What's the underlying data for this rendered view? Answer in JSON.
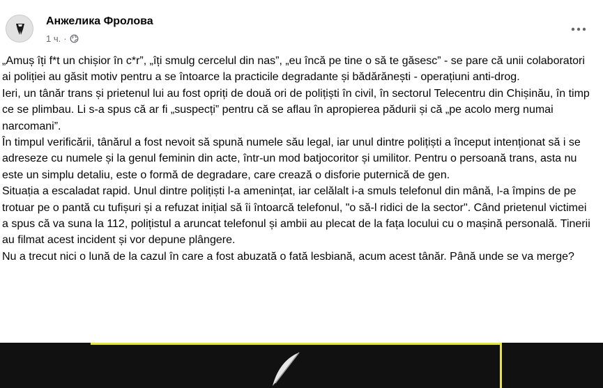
{
  "post": {
    "author": "Анжелика Фролова",
    "time": "1 ч.",
    "separator": "·",
    "privacy_icon": "globe-icon",
    "more_icon": "more-options-icon",
    "paragraphs": [
      "„Amuș îți f*t un chișior în c*r”, „îți smulg cercelul din nas”, „eu încă pe tine o să te găsesc” - se pare că unii colaboratori ai poliției au găsit motiv pentru a se întoarce la practicile degradante și bădărănești - operațiuni anti-drog.",
      "Ieri, un tânăr trans și prietenul lui au fost opriți de două ori de polițiști în civil, în sectorul Telecentru din Chișinău, în timp ce se plimbau. Li s-a spus că ar fi „suspecți” pentru că se aflau în apropierea pădurii și că „pe acolo merg numai narcomani”.",
      "În timpul verificării, tânărul a fost nevoit să spună numele său legal, iar unul dintre polițiști a început intenționat să i se adreseze cu numele și la genul feminin din acte, într-un mod batjocoritor și umilitor. Pentru o persoană trans, asta nu este un simplu detaliu, este o formă de degradare, care crează o disforie puternică de gen.",
      "Situația a escaladat rapid. Unul dintre polițiști l-a amenințat, iar celălalt i-a smuls telefonul din mână, l-a împins de pe trotuar pe o pantă cu tufișuri și a refuzat inițial să îi întoarcă telefonul, \"o să-l ridici de la sector\". Când prietenul victimei a spus că va suna la 112, polițistul a aruncat telefonul și ambii au plecat de la fața locului cu o mașină personală. Tinerii au filmat acest incident și vor depune plângere.",
      "Nu a trecut nici o lună de la cazul în care a fost abuzată o fată lesbiană, acum acest tânăr. Până unde se va merge?"
    ]
  },
  "colors": {
    "text": "#050505",
    "meta": "#65676b",
    "image_bg": "#111111",
    "accent_line": "#e8e24a"
  }
}
